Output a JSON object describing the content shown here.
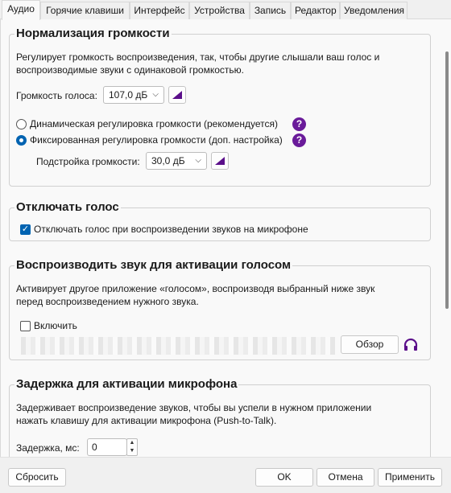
{
  "tabs": [
    "Аудио",
    "Горячие клавиши",
    "Интерфейс",
    "Устройства",
    "Запись",
    "Редактор",
    "Уведомления"
  ],
  "normalization": {
    "title": "Нормализация громкости",
    "description_line1": "Регулирует громкость воспроизведения, так, чтобы другие слышали ваш голос и",
    "description_line2": "воспроизводимые звуки с одинаковой громкостью.",
    "voice_volume_label": "Громкость голоса:",
    "voice_volume_value": "107,0 дБ",
    "dynamic_label": "Динамическая регулировка громкости (рекомендуется)",
    "fixed_label": "Фиксированная регулировка громкости (доп. настройка)",
    "selected_mode": "fixed",
    "tuning_label": "Подстройка громкости:",
    "tuning_value": "30,0 дБ"
  },
  "mute": {
    "title": "Отключать голос",
    "checkbox_label": "Отключать голос при воспроизведении звуков на микрофоне",
    "checked": true
  },
  "activation": {
    "title": "Воспроизводить звук для активации голосом",
    "description_line1": "Активирует другое приложение «голосом», воспроизводя выбранный ниже звук",
    "description_line2": "перед воспроизведением нужного звука.",
    "enable_label": "Включить",
    "enabled": false,
    "browse_label": "Обзор"
  },
  "delay": {
    "title": "Задержка для активации микрофона",
    "description_line1": "Задерживает воспроизведение звуков, чтобы вы успели в нужном приложении",
    "description_line2": "нажать клавишу для активации микрофона (Push-to-Talk).",
    "delay_label": "Задержка, мс:",
    "delay_value": "0"
  },
  "footer": {
    "reset": "Сбросить",
    "ok": "OK",
    "cancel": "Отмена",
    "apply": "Применить"
  },
  "colors": {
    "accent": "#0063b1",
    "help": "#6a1b9a",
    "icon_purple": "#5b0f8a"
  },
  "icons": [
    "volume-ramp-icon",
    "help-icon",
    "headphones-icon",
    "chevron-down-icon"
  ]
}
